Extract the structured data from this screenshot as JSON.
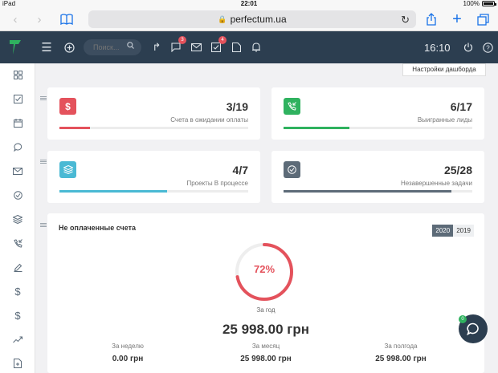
{
  "status_bar": {
    "device": "iPad",
    "time": "22:01",
    "battery": "100%"
  },
  "browser": {
    "url": "perfectum.ua"
  },
  "topbar": {
    "search_placeholder": "Поиск...",
    "badges": {
      "notes": "3",
      "tasks": "4"
    },
    "clock": "16:10"
  },
  "dashboard": {
    "settings_label": "Настройки дашборда"
  },
  "cards": [
    {
      "value": "3/19",
      "label": "Счета в ожидании оплаты",
      "color": "#e4525c",
      "progress": 0.16,
      "icon": "dollar-icon"
    },
    {
      "value": "6/17",
      "label": "Выигранные лиды",
      "color": "#2fb25f",
      "progress": 0.35,
      "icon": "phone-incoming-icon"
    },
    {
      "value": "4/7",
      "label": "Проекты В процессе",
      "color": "#4ab9d4",
      "progress": 0.57,
      "icon": "layers-icon"
    },
    {
      "value": "25/28",
      "label": "Незавершенные задачи",
      "color": "#5d6b78",
      "progress": 0.89,
      "icon": "check-circle-icon"
    }
  ],
  "unpaid": {
    "title": "Не оплаченные счета",
    "years": [
      "2020",
      "2019"
    ],
    "active_year": "2020",
    "percent": "72%",
    "percent_value": 0.72,
    "year_label": "За год",
    "year_value": "25 998.00 грн",
    "stats": [
      {
        "label": "За неделю",
        "value": "0.00 грн"
      },
      {
        "label": "За месяц",
        "value": "25 998.00 грн"
      },
      {
        "label": "За полгода",
        "value": "25 998.00 грн"
      }
    ]
  },
  "chat": {
    "badge": "0"
  }
}
